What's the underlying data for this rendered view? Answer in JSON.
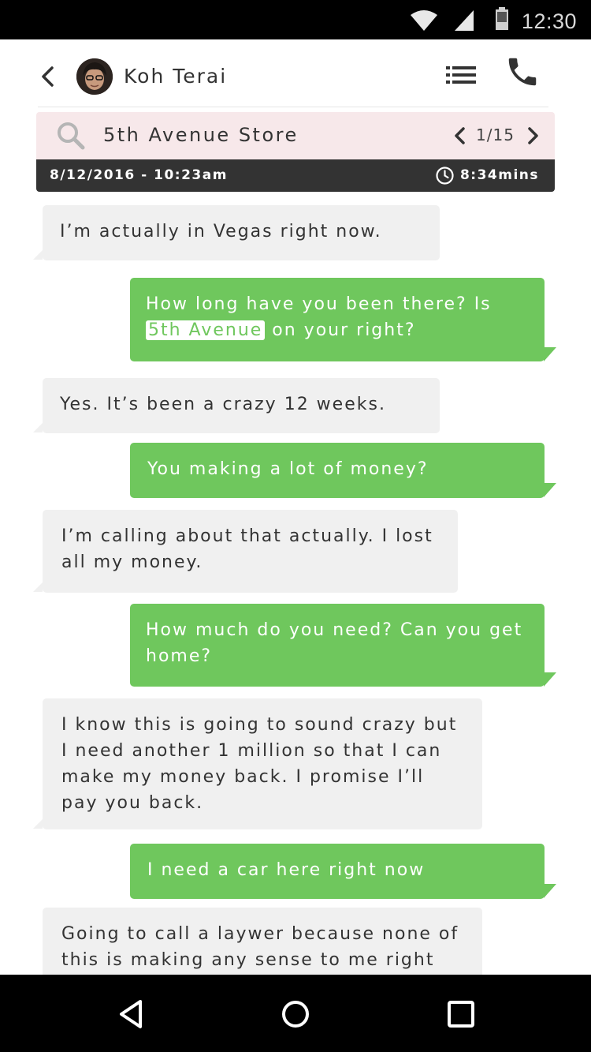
{
  "status_bar": {
    "time": "12:30"
  },
  "header": {
    "contact_name": "Koh Terai"
  },
  "search": {
    "query": "5th Avenue Store",
    "counter": "1/15"
  },
  "info": {
    "date": "8/12/2016 - 10:23am",
    "duration": "8:34mins"
  },
  "messages": [
    {
      "dir": "in",
      "text": "I’m actually in Vegas right now."
    },
    {
      "dir": "out",
      "pre": "How long have you been there? Is",
      "highlight": "5th Avenue",
      "post": "on your right?"
    },
    {
      "dir": "in",
      "text": "Yes. It’s been a crazy 12 weeks."
    },
    {
      "dir": "out",
      "text": "You making a lot of money?"
    },
    {
      "dir": "in",
      "line1": "I’m calling about that actually. I lost",
      "line2": "all my money."
    },
    {
      "dir": "out",
      "line1": "How much do you need? Can you get",
      "line2": "home?"
    },
    {
      "dir": "in",
      "line1": "I know this is going to sound crazy but",
      "line2": "I need another 1 million so that I can",
      "line3": "make my money back. I promise I’ll",
      "line4": "pay you back."
    },
    {
      "dir": "out",
      "text": "I need a car here right now"
    },
    {
      "dir": "in",
      "line1": "Going to call a laywer because none of",
      "line2": "this is making any sense to me right"
    }
  ],
  "colors": {
    "outgoing": "#6fc75d",
    "incoming": "#f0f0f0",
    "search_bg": "#f7e8ea",
    "info_bg": "#333333"
  }
}
